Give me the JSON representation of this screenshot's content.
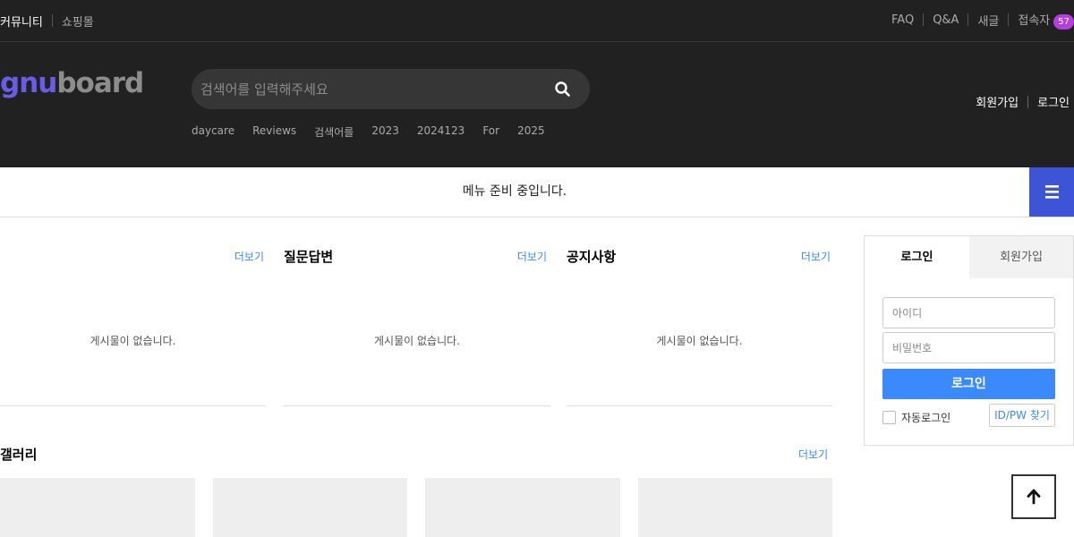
{
  "topbar": {
    "left": [
      "커뮤니티",
      "쇼핑몰"
    ],
    "right": [
      "FAQ",
      "Q&A",
      "새글",
      "접속자"
    ],
    "visitor_count": "57"
  },
  "header": {
    "logo_main": "gnu",
    "logo_sub": "board",
    "search_placeholder": "검색어를 입력해주세요",
    "popular": [
      "daycare",
      "Reviews",
      "검색어를",
      "2023",
      "2024123",
      "For",
      "2025"
    ],
    "join": "회원가입",
    "login": "로그인"
  },
  "nav": {
    "message": "메뉴 준비 중입니다."
  },
  "boards": [
    {
      "title": "",
      "more": "더보기",
      "empty": "게시물이 없습니다."
    },
    {
      "title": "질문답변",
      "more": "더보기",
      "empty": "게시물이 없습니다."
    },
    {
      "title": "공지사항",
      "more": "더보기",
      "empty": "게시물이 없습니다."
    }
  ],
  "gallery": {
    "title": "갤러리",
    "more": "더보기"
  },
  "login_box": {
    "tab_login": "로그인",
    "tab_join": "회원가입",
    "id_placeholder": "아이디",
    "pw_placeholder": "비밀번호",
    "submit": "로그인",
    "auto_login": "자동로그인",
    "find": "ID/PW 찾기"
  },
  "colors": {
    "dark_bg": "#212121",
    "accent_blue": "#3a8afd",
    "menu_blue": "#3d54d6",
    "badge_purple": "#b63edc"
  }
}
